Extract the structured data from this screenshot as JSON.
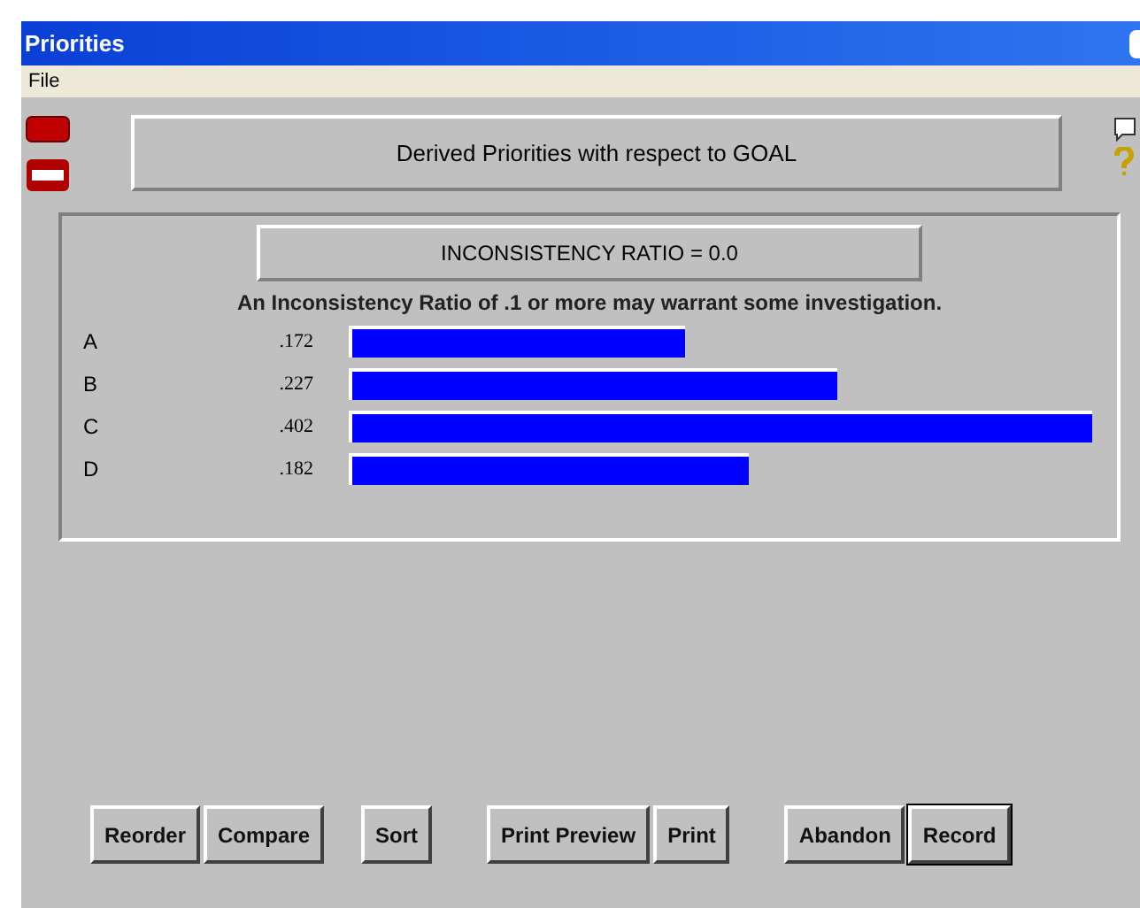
{
  "window": {
    "title": "Priorities"
  },
  "menu": [
    "File"
  ],
  "header": "Derived Priorities with respect to GOAL",
  "ratio": "INCONSISTENCY RATIO = 0.0",
  "note": "An Inconsistency Ratio of .1 or more may warrant some investigation.",
  "rows": [
    {
      "label": "A",
      "value": ".172"
    },
    {
      "label": "B",
      "value": ".227"
    },
    {
      "label": "C",
      "value": ".402"
    },
    {
      "label": "D",
      "value": ".182"
    }
  ],
  "button_groups": [
    [
      {
        "label": "Reorder",
        "default": false
      },
      {
        "label": "Compare",
        "default": false
      }
    ],
    [
      {
        "label": "Sort",
        "default": false
      }
    ],
    [
      {
        "label": "Print Preview",
        "default": false
      },
      {
        "label": "Print",
        "default": false
      }
    ],
    [
      {
        "label": "Abandon",
        "default": false
      },
      {
        "label": "Record",
        "default": true
      }
    ]
  ]
}
